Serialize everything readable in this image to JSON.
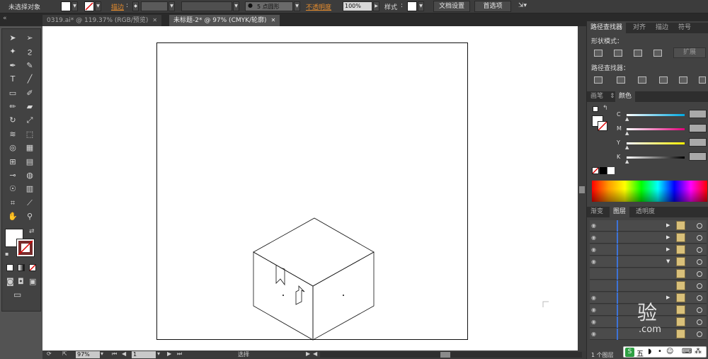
{
  "control_bar": {
    "selection_label": "未选择对象",
    "stroke_label": "描边",
    "stroke_sep": ":",
    "brush_label": "5 点圆形",
    "opacity_label": "不透明度",
    "opacity_value": "100%",
    "style_label": "样式",
    "style_sep": ":",
    "doc_setup_button": "文档设置",
    "preferences_button": "首选项"
  },
  "tabs": [
    {
      "label": "0319.ai* @ 119.37% (RGB/预览)",
      "close": "✕",
      "active": false
    },
    {
      "label": "未标题-2* @ 97% (CMYK/轮廓)",
      "close": "✕",
      "active": true
    }
  ],
  "tools": [
    {
      "name": "selection-tool",
      "glyph": "➤"
    },
    {
      "name": "direct-selection-tool",
      "glyph": "➢"
    },
    {
      "name": "magic-wand-tool",
      "glyph": "✦"
    },
    {
      "name": "lasso-tool",
      "glyph": "ϩ"
    },
    {
      "name": "pen-tool",
      "glyph": "✒"
    },
    {
      "name": "curvature-tool",
      "glyph": "✎"
    },
    {
      "name": "type-tool",
      "glyph": "T"
    },
    {
      "name": "line-tool",
      "glyph": "╱"
    },
    {
      "name": "rectangle-tool",
      "glyph": "▭"
    },
    {
      "name": "paintbrush-tool",
      "glyph": "✐"
    },
    {
      "name": "pencil-tool",
      "glyph": "✏"
    },
    {
      "name": "eraser-tool",
      "glyph": "▰"
    },
    {
      "name": "rotate-tool",
      "glyph": "↻"
    },
    {
      "name": "scale-tool",
      "glyph": "⤢"
    },
    {
      "name": "warp-tool",
      "glyph": "≋"
    },
    {
      "name": "free-transform-tool",
      "glyph": "⬚"
    },
    {
      "name": "shape-builder-tool",
      "glyph": "◎"
    },
    {
      "name": "perspective-grid-tool",
      "glyph": "▦"
    },
    {
      "name": "mesh-tool",
      "glyph": "⊞"
    },
    {
      "name": "gradient-tool",
      "glyph": "▤"
    },
    {
      "name": "eyedropper-tool",
      "glyph": "⊸"
    },
    {
      "name": "blend-tool",
      "glyph": "◍"
    },
    {
      "name": "symbol-sprayer-tool",
      "glyph": "☉"
    },
    {
      "name": "column-graph-tool",
      "glyph": "▥"
    },
    {
      "name": "artboard-tool",
      "glyph": "⌗"
    },
    {
      "name": "slice-tool",
      "glyph": "⟋"
    },
    {
      "name": "hand-tool",
      "glyph": "✋"
    },
    {
      "name": "zoom-tool",
      "glyph": "⚲"
    }
  ],
  "status": {
    "zoom": "97%",
    "page": "1",
    "mode": "选择"
  },
  "pathfinder": {
    "tabs": [
      "路径查找器",
      "对齐",
      "描边",
      "符号"
    ],
    "shape_modes_label": "形状模式：",
    "expand_button": "扩展",
    "pathfinders_label": "路径查找器："
  },
  "color_panel": {
    "tabs": [
      "画笔",
      "颜色"
    ],
    "channels": [
      {
        "label": "C",
        "gradient": "linear-gradient(90deg,#ffffff,#00a8e0)"
      },
      {
        "label": "M",
        "gradient": "linear-gradient(90deg,#ffffff,#e2007a)"
      },
      {
        "label": "Y",
        "gradient": "linear-gradient(90deg,#ffffff,#fff000)"
      },
      {
        "label": "K",
        "gradient": "linear-gradient(90deg,#ffffff,#000000)"
      }
    ]
  },
  "layers_panel": {
    "tabs": [
      "渐变",
      "图层",
      "透明度"
    ],
    "footer": "1 个图层",
    "rows": [
      {
        "eye": "◉",
        "arrow": "▶"
      },
      {
        "eye": "◉",
        "arrow": "▶"
      },
      {
        "eye": "◉",
        "arrow": "▶"
      },
      {
        "eye": "◉",
        "arrow": "▼"
      },
      {
        "eye": "",
        "arrow": ""
      },
      {
        "eye": "",
        "arrow": ""
      },
      {
        "eye": "◉",
        "arrow": "▶"
      },
      {
        "eye": "◉",
        "arrow": ""
      },
      {
        "eye": "◉",
        "arrow": ""
      },
      {
        "eye": "◉",
        "arrow": ""
      }
    ]
  },
  "overlay": {
    "ime_label": "五",
    "watermark": "验",
    "watermark_sub": ".com"
  },
  "colors": {
    "accent_orange": "#e38b2e",
    "layer_blue": "#3d73d8"
  }
}
